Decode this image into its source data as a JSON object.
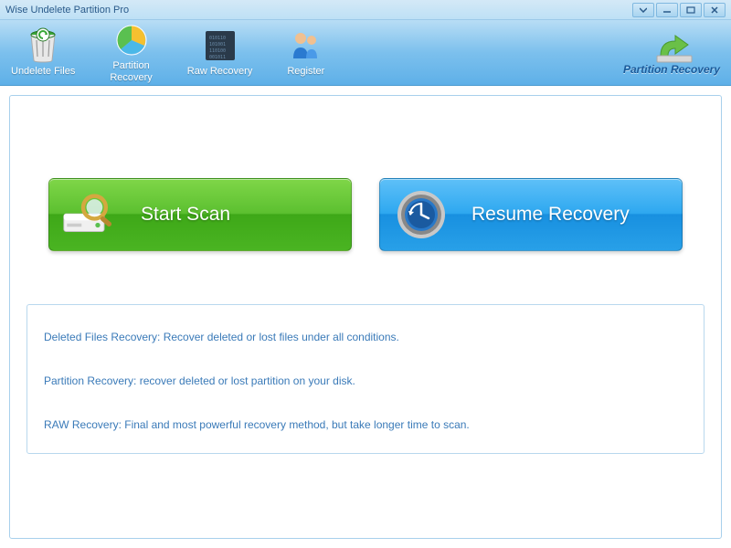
{
  "window": {
    "title": "Wise Undelete Partition Pro"
  },
  "toolbar": {
    "items": [
      {
        "label": "Undelete Files"
      },
      {
        "label": "Partition\nRecovery"
      },
      {
        "label": "Raw Recovery"
      },
      {
        "label": "Register"
      }
    ]
  },
  "logo": {
    "text": "Partition Recovery"
  },
  "actions": {
    "start_scan": "Start  Scan",
    "resume_recovery": "Resume Recovery"
  },
  "info": {
    "line1": "Deleted Files Recovery: Recover deleted or lost files  under all conditions.",
    "line2": "Partition Recovery: recover deleted or lost partition on your disk.",
    "line3": "RAW Recovery: Final and most powerful recovery method, but take longer time to scan."
  }
}
